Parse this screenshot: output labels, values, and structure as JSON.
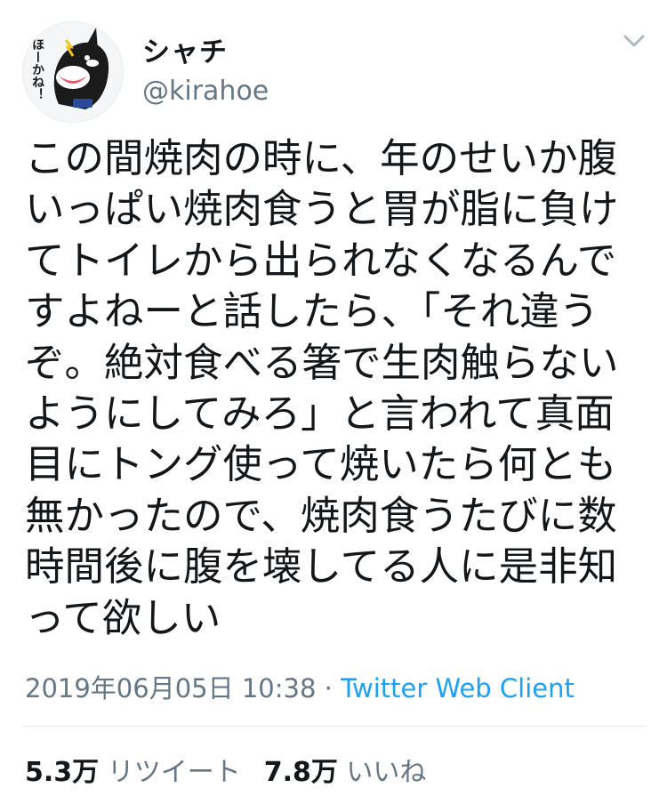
{
  "author": {
    "display_name": "シャチ",
    "handle": "@kirahoe",
    "avatar_icon": "orca-cartoon-avatar",
    "avatar_caption": "ほーかね！"
  },
  "tweet": {
    "lines": [
      "この間焼肉の時に、年のせいか腹",
      "いっぱい焼肉食うと胃が脂に負け",
      "てトイレから出られなくなるんで",
      "すよねーと話したら、「それ違う",
      "ぞ。絶対食べる箸で生肉触らない",
      "ようにしてみろ」と言われて真面",
      "目にトング使って焼いたら何とも",
      "無かったので、焼肉食うたびに数",
      "時間後に腹を壊してる人に是非知",
      "って欲しい"
    ],
    "timestamp": "2019年06月05日 10:38",
    "separator": " · ",
    "source": "Twitter Web Client"
  },
  "stats": {
    "retweets_count": "5.3万",
    "retweets_label": "リツイート",
    "likes_count": "7.8万",
    "likes_label": "いいね"
  },
  "colors": {
    "text": "#14171a",
    "secondary": "#657786",
    "link": "#1da1f2",
    "divider": "#e1e8ed"
  },
  "menu_icon": "chevron-down-icon"
}
